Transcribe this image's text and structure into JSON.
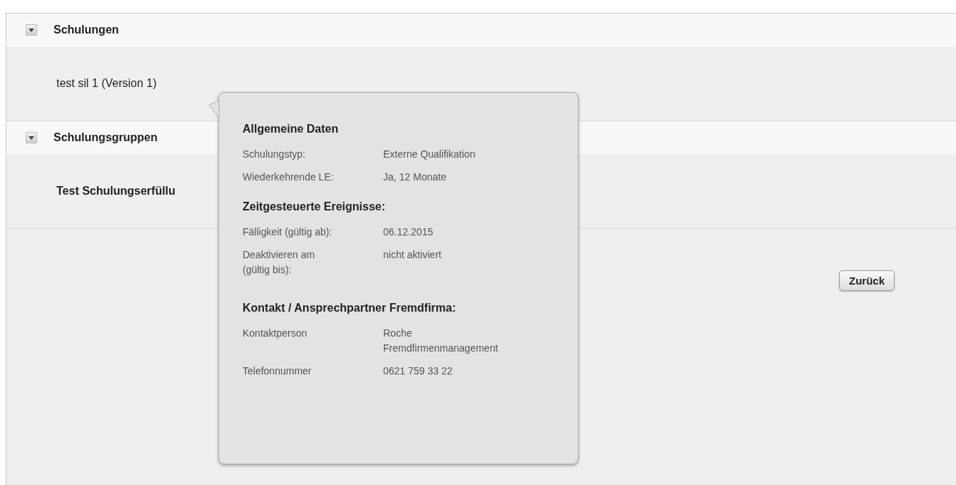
{
  "sections": [
    {
      "title": "Schulungen",
      "expanded": true,
      "items": [
        {
          "text": "test sil 1 (Version 1)",
          "bold": false
        }
      ]
    },
    {
      "title": "Schulungsgruppen",
      "expanded": true,
      "items": [
        {
          "text": "Test Schulungserfüllu",
          "bold": true
        }
      ]
    }
  ],
  "tooltip": {
    "groups": [
      {
        "heading": "Allgemeine Daten",
        "rows": [
          {
            "label": "Schulungstyp:",
            "value": "Externe Qualifikation"
          },
          {
            "label": "Wiederkehrende LE:",
            "value": "Ja, 12 Monate"
          }
        ]
      },
      {
        "heading": "Zeitgesteuerte Ereignisse:",
        "rows": [
          {
            "label": "Fälligkeit (gültig ab):",
            "value": "06.12.2015"
          },
          {
            "label": "Deaktivieren am (gültig bis):",
            "value": "nicht aktiviert"
          }
        ]
      },
      {
        "heading": "Kontakt / Ansprechpartner Fremdfirma:",
        "rows": [
          {
            "label": "Kontaktperson",
            "value": "Roche Fremdfirmenmanagement"
          },
          {
            "label": "Telefonnummer",
            "value": "0621 759 33 22"
          }
        ]
      }
    ]
  },
  "buttons": [
    {
      "label": "Zurück"
    }
  ]
}
